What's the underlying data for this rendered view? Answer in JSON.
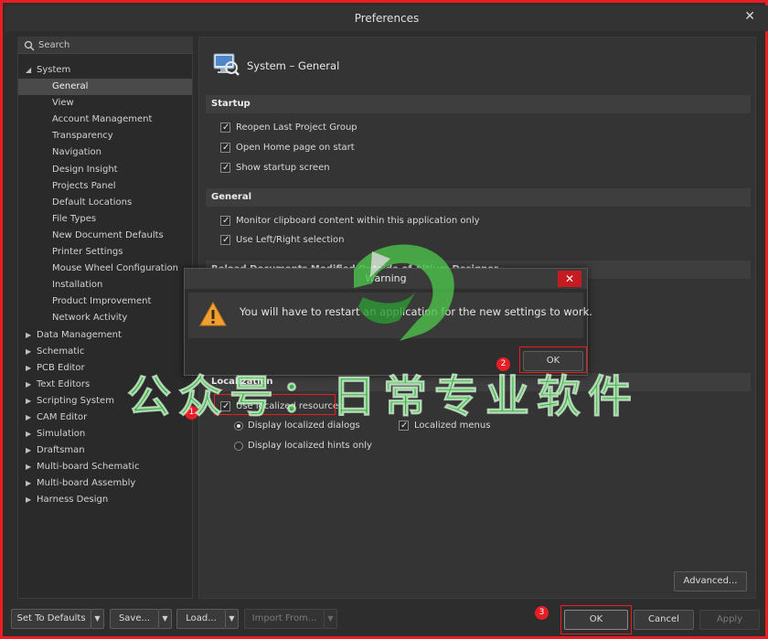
{
  "window": {
    "title": "Preferences",
    "close_glyph": "✕"
  },
  "search": {
    "placeholder": "Search"
  },
  "tree": [
    {
      "label": "System",
      "level": 0,
      "expanded": true
    },
    {
      "label": "General",
      "level": 1,
      "selected": true
    },
    {
      "label": "View",
      "level": 1
    },
    {
      "label": "Account Management",
      "level": 1
    },
    {
      "label": "Transparency",
      "level": 1
    },
    {
      "label": "Navigation",
      "level": 1
    },
    {
      "label": "Design Insight",
      "level": 1
    },
    {
      "label": "Projects Panel",
      "level": 1
    },
    {
      "label": "Default Locations",
      "level": 1
    },
    {
      "label": "File Types",
      "level": 1
    },
    {
      "label": "New Document Defaults",
      "level": 1
    },
    {
      "label": "Printer Settings",
      "level": 1
    },
    {
      "label": "Mouse Wheel Configuration",
      "level": 1
    },
    {
      "label": "Installation",
      "level": 1
    },
    {
      "label": "Product Improvement",
      "level": 1
    },
    {
      "label": "Network Activity",
      "level": 1
    },
    {
      "label": "Data Management",
      "level": 0
    },
    {
      "label": "Schematic",
      "level": 0
    },
    {
      "label": "PCB Editor",
      "level": 0
    },
    {
      "label": "Text Editors",
      "level": 0
    },
    {
      "label": "Scripting System",
      "level": 0
    },
    {
      "label": "CAM Editor",
      "level": 0
    },
    {
      "label": "Simulation",
      "level": 0
    },
    {
      "label": "Draftsman",
      "level": 0
    },
    {
      "label": "Multi-board Schematic",
      "level": 0
    },
    {
      "label": "Multi-board Assembly",
      "level": 0
    },
    {
      "label": "Harness Design",
      "level": 0
    }
  ],
  "page": {
    "title": "System – General"
  },
  "startup": {
    "header": "Startup",
    "reopen": "Reopen Last Project Group",
    "open_home": "Open Home page on start",
    "show_startup": "Show startup screen"
  },
  "general": {
    "header": "General",
    "monitor_clipboard": "Monitor clipboard content within this application only",
    "use_lr": "Use Left/Right selection"
  },
  "reload": {
    "header": "Reload Documents Modified Outside of Altium Designer"
  },
  "localization": {
    "header": "Localization",
    "use_localized": "Use localized resources",
    "display_dialogs": "Display localized dialogs",
    "display_hints": "Display localized hints only",
    "localized_menus": "Localized menus"
  },
  "buttons": {
    "advanced": "Advanced...",
    "set_defaults": "Set To Defaults",
    "save": "Save...",
    "load": "Load...",
    "import": "Import From...",
    "ok": "OK",
    "cancel": "Cancel",
    "apply": "Apply"
  },
  "warning": {
    "title": "Warning",
    "close_glyph": "✕",
    "message": "You will have to restart an application for the new settings to work.",
    "ok": "OK"
  },
  "annotations": {
    "step1": "1",
    "step2": "2",
    "step3": "3"
  },
  "watermark": {
    "text": "公众号：日常专业软件"
  },
  "colors": {
    "highlight": "#e81e25",
    "background": "#2d2d2d",
    "watermark": "#3cc846"
  }
}
